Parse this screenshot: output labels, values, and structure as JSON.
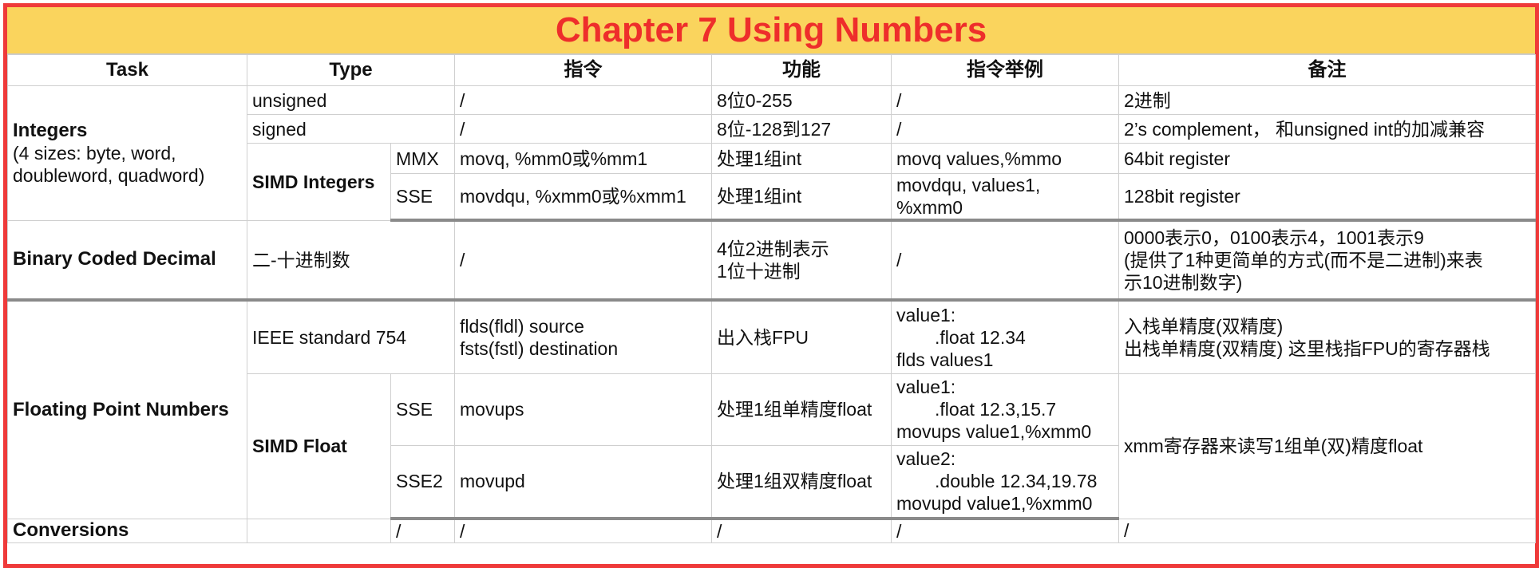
{
  "title": "Chapter 7 Using Numbers",
  "headers": {
    "task": "Task",
    "type": "Type",
    "instruction": "指令",
    "function": "功能",
    "example": "指令举例",
    "note": "备注"
  },
  "integers": {
    "task_title": "Integers",
    "task_sub1": "(4 sizes: byte, word,",
    "task_sub2": "doubleword, quadword)",
    "unsigned": {
      "type": "unsigned",
      "instr": "/",
      "func": "8位0-255",
      "example": "/",
      "note": "2进制"
    },
    "signed": {
      "type": "signed",
      "instr": "/",
      "func": "8位-128到127",
      "example": "/",
      "note": "2’s complement， 和unsigned int的加减兼容"
    },
    "simd_label": "SIMD Integers",
    "mmx": {
      "sub": "MMX",
      "instr": "movq, %mm0或%mm1",
      "func": "处理1组int",
      "example": "movq values,%mmo",
      "note": "64bit register"
    },
    "sse": {
      "sub": "SSE",
      "instr": "movdqu, %xmm0或%xmm1",
      "func": "处理1组int",
      "example1": "movdqu, values1,",
      "example2": "%xmm0",
      "note": "128bit register"
    }
  },
  "bcd": {
    "task": "Binary Coded Decimal",
    "type": "二-十进制数",
    "instr": "/",
    "func1": "4位2进制表示",
    "func2": "1位十进制",
    "example": "/",
    "note1": "0000表示0，0100表示4，1001表示9",
    "note2": "(提供了1种更简单的方式(而不是二进制)来表",
    "note3": "示10进制数字)"
  },
  "float": {
    "task": "Floating Point Numbers",
    "ieee": {
      "type": "IEEE standard 754",
      "instr1": "flds(fldl) source",
      "instr2": "fsts(fstl) destination",
      "func": "出入栈FPU",
      "ex1": "value1:",
      "ex2": ".float 12.34",
      "ex3": "flds values1",
      "note1": "入栈单精度(双精度)",
      "note2": "出栈单精度(双精度) 这里栈指FPU的寄存器栈"
    },
    "simd_label": "SIMD Float",
    "sse": {
      "sub": "SSE",
      "instr": "movups",
      "func": "处理1组单精度float",
      "ex1": "value1:",
      "ex2": ".float 12.3,15.7",
      "ex3": "movups value1,%xmm0"
    },
    "sse2": {
      "sub": "SSE2",
      "instr": "movupd",
      "func": "处理1组双精度float",
      "ex1": "value2:",
      "ex2": ".double 12.34,19.78",
      "ex3": "movupd value1,%xmm0"
    },
    "simd_note": "xmm寄存器来读写1组单(双)精度float"
  },
  "conversions": {
    "task": "Conversions",
    "type": "",
    "sub": "/",
    "instr": "/",
    "func": "/",
    "example": "/",
    "note": "/"
  },
  "colors": {
    "title_bg": "#fad45d",
    "title_text": "#ee2e2b",
    "frame": "#ef3a3a",
    "separator": "#8a8a8a"
  }
}
